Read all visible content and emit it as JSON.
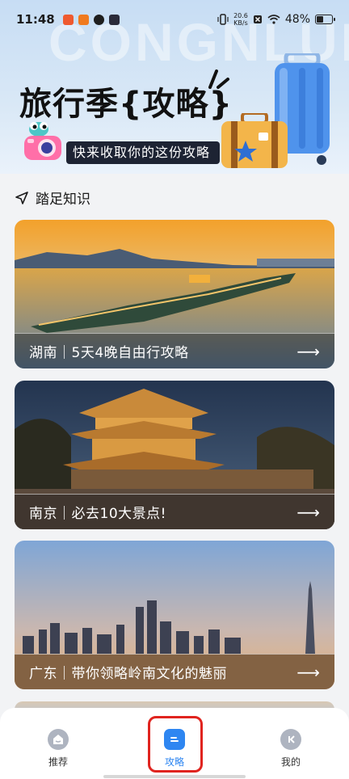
{
  "status_bar": {
    "time": "11:48",
    "net_speed_value": "20.6",
    "net_speed_unit": "KB/s",
    "battery_percent_text": "48%",
    "battery_level": 0.48
  },
  "banner": {
    "bg_text": "CONGNLUE",
    "title_main": "旅行季",
    "title_left_brace": "{",
    "title_highlight": "攻略",
    "title_right_brace": "}",
    "subtitle": "快来收取你的这份攻略"
  },
  "section": {
    "icon": "navigation-arrow-icon",
    "title": "踏足知识"
  },
  "cards": [
    {
      "title": "湖南｜5天4晚自由行攻略",
      "arrow": "⟶"
    },
    {
      "title": "南京｜必去10大景点!",
      "arrow": "⟶"
    },
    {
      "title": "广东｜带你领略岭南文化的魅丽",
      "arrow": "⟶"
    }
  ],
  "nav": {
    "items": [
      {
        "label": "推荐",
        "icon": "home-smile-icon",
        "active": false
      },
      {
        "label": "攻略",
        "icon": "guide-book-icon",
        "active": true
      },
      {
        "label": "我的",
        "icon": "profile-icon",
        "active": false
      }
    ]
  },
  "colors": {
    "accent": "#2e86f1",
    "highlight_frame": "#e0241f",
    "nav_inactive": "#aeb4c0"
  }
}
